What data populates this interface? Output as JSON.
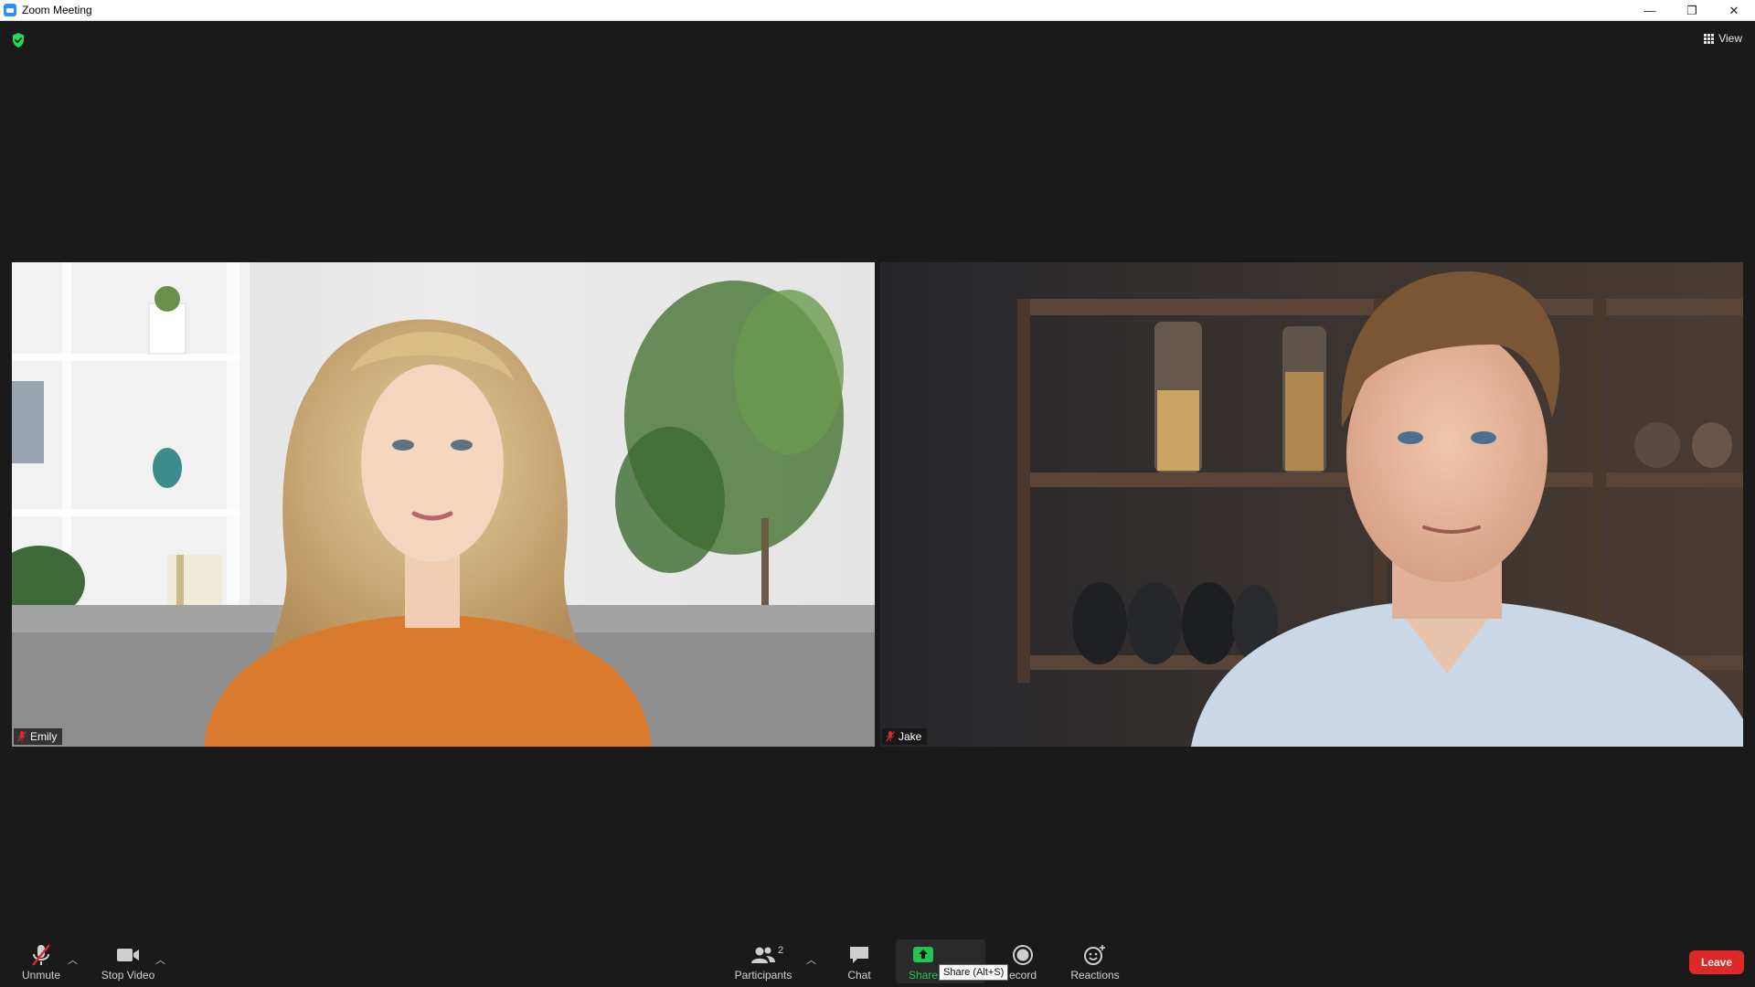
{
  "window": {
    "title": "Zoom Meeting",
    "controls": {
      "minimize": "—",
      "restore": "❐",
      "close": "✕"
    }
  },
  "header": {
    "view_label": "View"
  },
  "participants_video": [
    {
      "name": "Emily",
      "muted": true
    },
    {
      "name": "Jake",
      "muted": true
    }
  ],
  "toolbar": {
    "unmute_label": "Unmute",
    "stop_video_label": "Stop Video",
    "participants_label": "Participants",
    "participants_count": "2",
    "chat_label": "Chat",
    "share_label": "Share",
    "record_label": "ecord",
    "reactions_label": "Reactions",
    "leave_label": "Leave",
    "share_tooltip": "Share (Alt+S)"
  },
  "colors": {
    "background": "#1a1a1a",
    "share_green": "#25c451",
    "leave_red": "#e02828",
    "mute_red": "#e02828",
    "security_green": "#23d959"
  }
}
